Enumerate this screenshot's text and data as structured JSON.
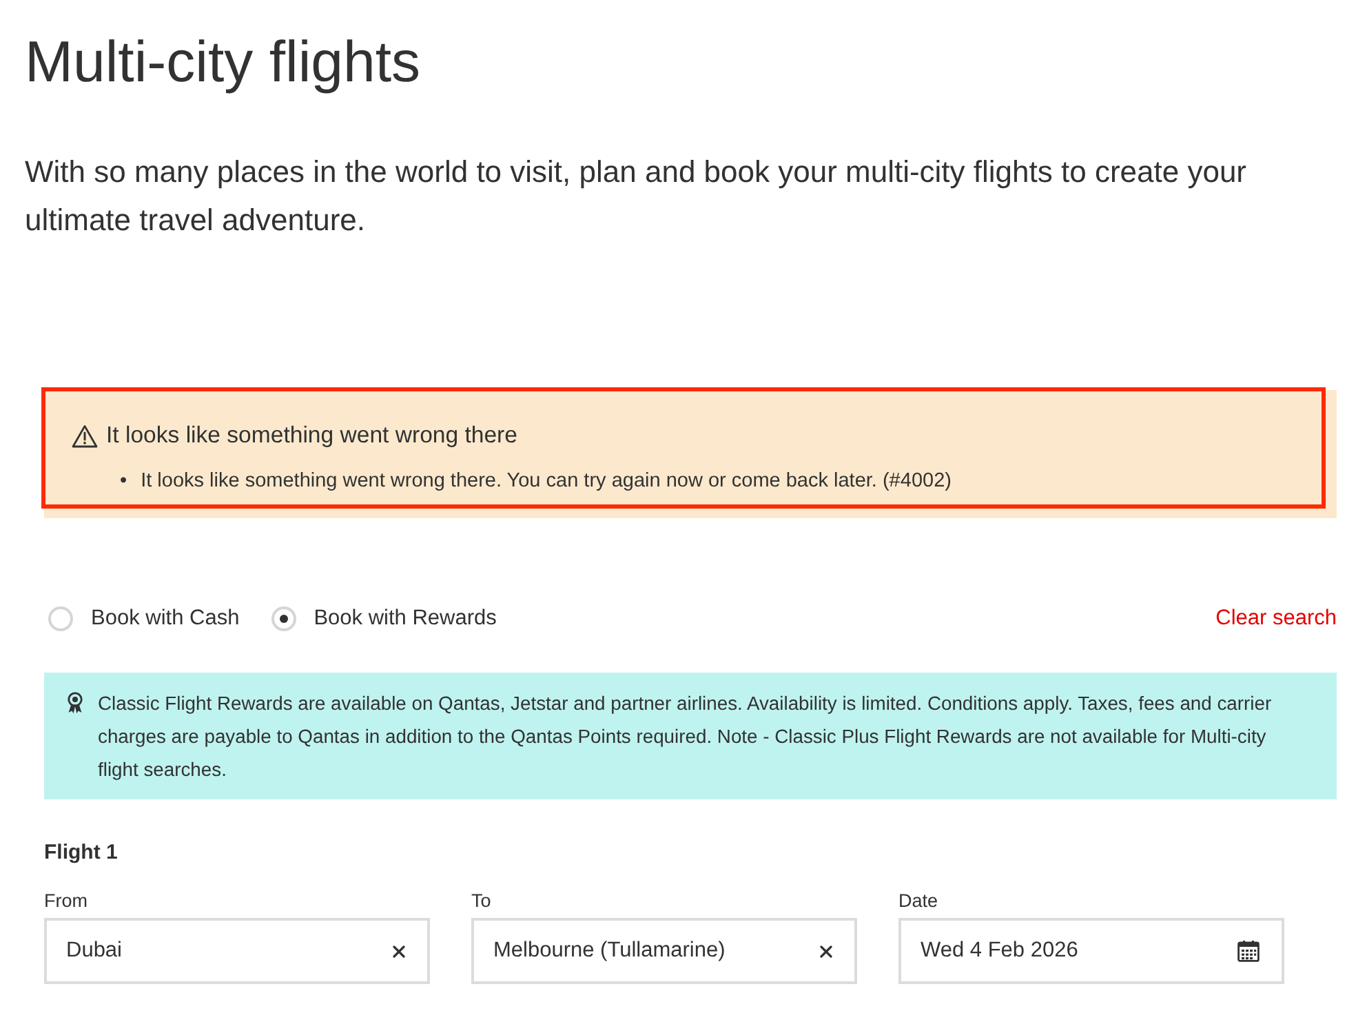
{
  "page": {
    "title": "Multi-city flights",
    "intro": "With so many places in the world to visit, plan and book your multi-city flights to create your ultimate travel adventure."
  },
  "error_alert": {
    "heading": "It looks like something went wrong there",
    "messages": [
      {
        "bullet": "•",
        "text": "It looks like something went wrong there. You can try again now or come back later. (#4002)"
      }
    ],
    "highlighted": true
  },
  "booking_type": {
    "options": [
      {
        "label": "Book with Cash",
        "selected": false
      },
      {
        "label": "Book with Rewards",
        "selected": true
      }
    ],
    "clear_link": "Clear search"
  },
  "rewards_notice": {
    "text": "Classic Flight Rewards are available on Qantas, Jetstar and partner airlines. Availability is limited. Conditions apply. Taxes, fees and carrier charges are payable to Qantas in addition to the Qantas Points required. Note - Classic Plus Flight Rewards are not available for Multi-city flight searches."
  },
  "flights": [
    {
      "heading": "Flight 1",
      "fields": [
        {
          "kind": "location",
          "label": "From",
          "value": "Dubai"
        },
        {
          "kind": "location",
          "label": "To",
          "value": "Melbourne (Tullamarine)"
        },
        {
          "kind": "date",
          "label": "Date",
          "value": "Wed 4 Feb 2026"
        }
      ]
    }
  ]
}
